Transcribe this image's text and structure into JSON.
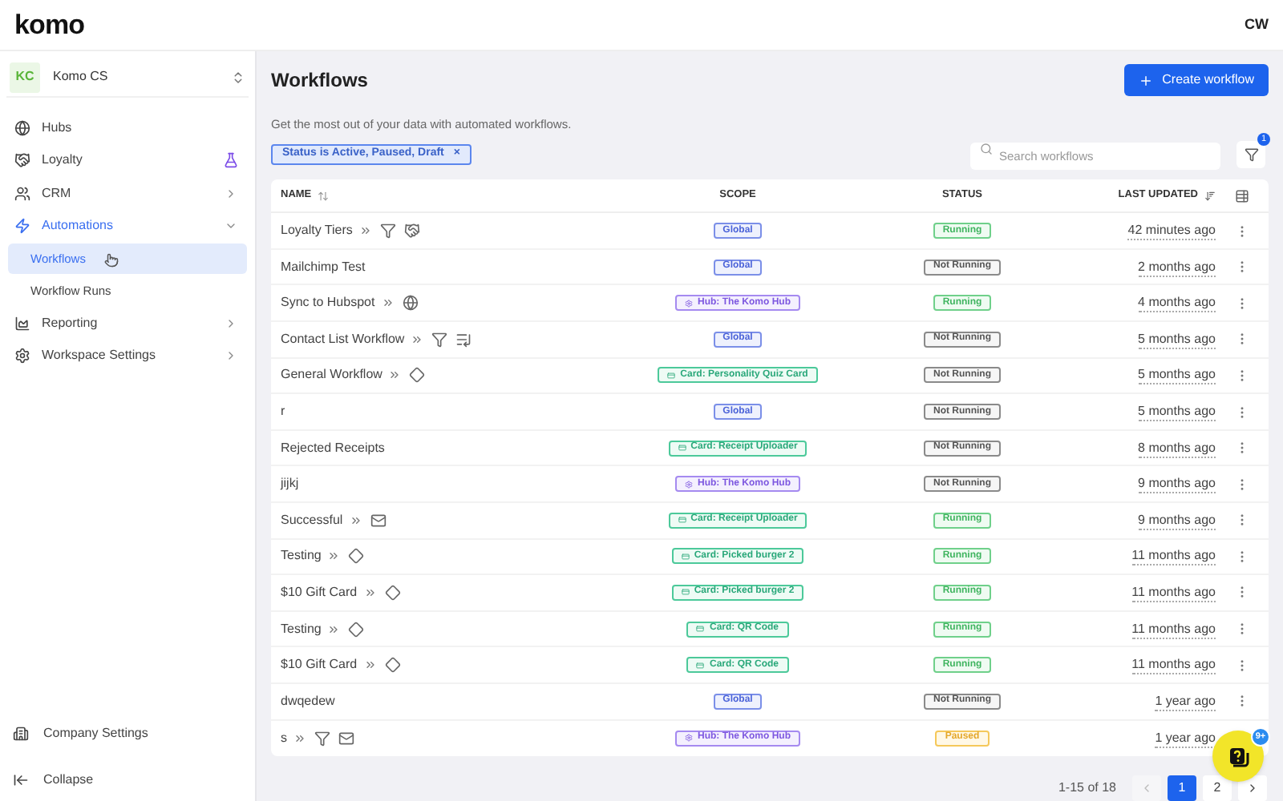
{
  "logo": "komo",
  "user": {
    "initials": "CW"
  },
  "workspace": {
    "initials": "KC",
    "name": "Komo CS"
  },
  "nav": [
    {
      "label": "Hubs",
      "kind": "plain",
      "active": false
    },
    {
      "label": "Loyalty",
      "kind": "beta",
      "active": false
    },
    {
      "label": "CRM",
      "kind": "group",
      "expanded": false,
      "active": false
    },
    {
      "label": "Automations",
      "kind": "group",
      "expanded": true,
      "active": true,
      "children": [
        {
          "label": "Workflows",
          "selected": true
        },
        {
          "label": "Workflow Runs",
          "selected": false
        }
      ]
    },
    {
      "label": "Reporting",
      "kind": "group",
      "expanded": false,
      "active": false
    },
    {
      "label": "Workspace Settings",
      "kind": "group",
      "expanded": false,
      "active": false
    }
  ],
  "sidebar_footer": [
    {
      "label": "Company Settings"
    },
    {
      "label": "Collapse"
    }
  ],
  "page": {
    "title": "Workflows",
    "subtitle": "Get the most out of your data with automated workflows.",
    "create_button": "Create workflow"
  },
  "filter_chip": {
    "label": "Status is Active, Paused, Draft",
    "close": "×"
  },
  "search": {
    "placeholder": "Search workflows"
  },
  "filter_button": {
    "badge": "1"
  },
  "table": {
    "columns": [
      "NAME",
      "SCOPE",
      "STATUS",
      "LAST UPDATED"
    ],
    "rows": [
      {
        "name": "Loyalty Tiers",
        "icons": [
          {
            "kind": "funnel"
          },
          {
            "kind": "handshake"
          }
        ],
        "scope": {
          "kind": "global",
          "label": "Global"
        },
        "status": {
          "kind": "running",
          "label": "Running"
        },
        "updated": "42 minutes ago"
      },
      {
        "name": "Mailchimp Test",
        "icons": [],
        "scope": {
          "kind": "global",
          "label": "Global"
        },
        "status": {
          "kind": "stopped",
          "label": "Not Running"
        },
        "updated": "2 months ago"
      },
      {
        "name": "Sync to Hubspot",
        "icons": [
          {
            "kind": "globe"
          }
        ],
        "scope": {
          "kind": "hub",
          "label": "Hub: The Komo Hub"
        },
        "status": {
          "kind": "running",
          "label": "Running"
        },
        "updated": "4 months ago"
      },
      {
        "name": "Contact List Workflow",
        "icons": [
          {
            "kind": "funnel"
          },
          {
            "kind": "list"
          }
        ],
        "scope": {
          "kind": "global",
          "label": "Global"
        },
        "status": {
          "kind": "stopped",
          "label": "Not Running"
        },
        "updated": "5 months ago"
      },
      {
        "name": "General Workflow",
        "icons": [
          {
            "kind": "diamond"
          }
        ],
        "scope": {
          "kind": "card",
          "label": "Card: Personality Quiz Card"
        },
        "status": {
          "kind": "stopped",
          "label": "Not Running"
        },
        "updated": "5 months ago"
      },
      {
        "name": "r",
        "icons": [],
        "scope": {
          "kind": "global",
          "label": "Global"
        },
        "status": {
          "kind": "stopped",
          "label": "Not Running"
        },
        "updated": "5 months ago"
      },
      {
        "name": "Rejected Receipts",
        "icons": [],
        "scope": {
          "kind": "card",
          "label": "Card: Receipt Uploader"
        },
        "status": {
          "kind": "stopped",
          "label": "Not Running"
        },
        "updated": "8 months ago"
      },
      {
        "name": "jijkj",
        "icons": [],
        "scope": {
          "kind": "hub",
          "label": "Hub: The Komo Hub"
        },
        "status": {
          "kind": "stopped",
          "label": "Not Running"
        },
        "updated": "9 months ago"
      },
      {
        "name": "Successful",
        "icons": [
          {
            "kind": "mail"
          }
        ],
        "scope": {
          "kind": "card",
          "label": "Card: Receipt Uploader"
        },
        "status": {
          "kind": "running",
          "label": "Running"
        },
        "updated": "9 months ago"
      },
      {
        "name": "Testing",
        "icons": [
          {
            "kind": "diamond"
          }
        ],
        "scope": {
          "kind": "card",
          "label": "Card: Picked burger 2"
        },
        "status": {
          "kind": "running",
          "label": "Running"
        },
        "updated": "11 months ago"
      },
      {
        "name": "$10 Gift Card",
        "icons": [
          {
            "kind": "diamond"
          }
        ],
        "scope": {
          "kind": "card",
          "label": "Card: Picked burger 2"
        },
        "status": {
          "kind": "running",
          "label": "Running"
        },
        "updated": "11 months ago"
      },
      {
        "name": "Testing",
        "icons": [
          {
            "kind": "diamond"
          }
        ],
        "scope": {
          "kind": "card",
          "label": "Card: QR Code"
        },
        "status": {
          "kind": "running",
          "label": "Running"
        },
        "updated": "11 months ago"
      },
      {
        "name": "$10 Gift Card",
        "icons": [
          {
            "kind": "diamond"
          }
        ],
        "scope": {
          "kind": "card",
          "label": "Card: QR Code"
        },
        "status": {
          "kind": "running",
          "label": "Running"
        },
        "updated": "11 months ago"
      },
      {
        "name": "dwqedew",
        "icons": [],
        "scope": {
          "kind": "global",
          "label": "Global"
        },
        "status": {
          "kind": "stopped",
          "label": "Not Running"
        },
        "updated": "1 year ago"
      },
      {
        "name": "s",
        "icons": [
          {
            "kind": "funnel"
          },
          {
            "kind": "mail"
          }
        ],
        "scope": {
          "kind": "hub",
          "label": "Hub: The Komo Hub"
        },
        "status": {
          "kind": "paused",
          "label": "Paused"
        },
        "updated": "1 year ago"
      }
    ]
  },
  "pagination": {
    "range": "1-15 of 18",
    "prev_disabled": true,
    "pages": [
      {
        "label": "1",
        "selected": true
      },
      {
        "label": "2",
        "selected": false
      }
    ]
  },
  "help": {
    "badge": "9+"
  }
}
